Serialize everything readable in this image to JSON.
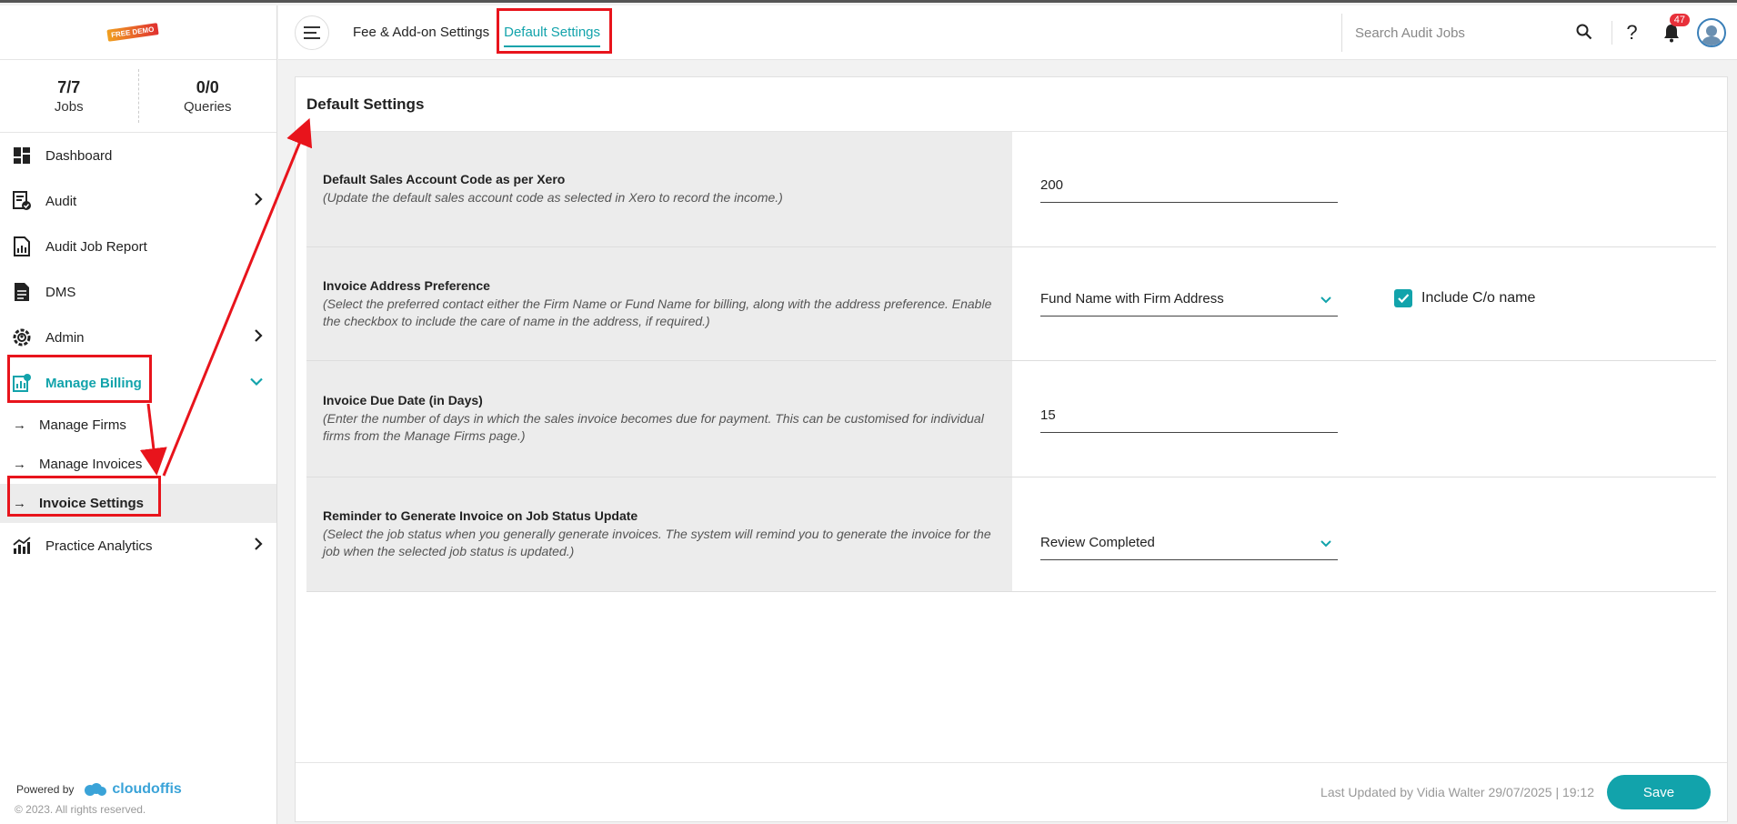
{
  "logo": {
    "badge_text": "FREE DEMO"
  },
  "stats": [
    {
      "value": "7/7",
      "label": "Jobs"
    },
    {
      "value": "0/0",
      "label": "Queries"
    }
  ],
  "sidebar": {
    "items": [
      {
        "label": "Dashboard",
        "icon": "dashboard-icon"
      },
      {
        "label": "Audit",
        "icon": "audit-icon"
      },
      {
        "label": "Audit Job Report",
        "icon": "report-icon"
      },
      {
        "label": "DMS",
        "icon": "document-icon"
      },
      {
        "label": "Admin",
        "icon": "admin-gear-icon"
      },
      {
        "label": "Manage Billing",
        "icon": "billing-icon"
      },
      {
        "label": "Practice Analytics",
        "icon": "analytics-icon"
      }
    ],
    "billing_sub": [
      {
        "label": "Manage Firms"
      },
      {
        "label": "Manage Invoices"
      },
      {
        "label": "Invoice Settings"
      }
    ],
    "powered_by": "Powered by",
    "brand": "cloudoffis",
    "copyright": "© 2023. All rights reserved."
  },
  "topbar": {
    "tabs": [
      {
        "label": "Fee & Add-on Settings"
      },
      {
        "label": "Default Settings"
      }
    ],
    "search_placeholder": "Search Audit Jobs",
    "help": "?",
    "notification_count": "47"
  },
  "main": {
    "title": "Default Settings",
    "rows": [
      {
        "title": "Default Sales Account Code as per Xero",
        "desc": "(Update the default sales account code as selected in Xero to record the income.)",
        "value": "200"
      },
      {
        "title": "Invoice Address Preference",
        "desc": "(Select the preferred contact either the Firm Name or Fund Name for billing, along with the address preference. Enable the checkbox to include the care of name in the address, if required.)",
        "value": "Fund Name with Firm Address",
        "checkbox_label": "Include C/o name"
      },
      {
        "title": "Invoice Due Date (in Days)",
        "desc": "(Enter the number of days in which the sales invoice becomes due for payment. This can be customised for individual firms from the Manage Firms page.)",
        "value": "15"
      },
      {
        "title": "Reminder to Generate Invoice on Job Status Update",
        "desc": "(Select the job status when you generally generate invoices. The system will remind you to generate the invoice for the job when the selected job status is updated.)",
        "value": "Review Completed"
      }
    ],
    "last_updated": "Last Updated by Vidia Walter 29/07/2025 | 19:12",
    "save_label": "Save"
  },
  "colors": {
    "accent": "#12a3ab",
    "annotation": "#e8141c",
    "badge": "#e8303a"
  }
}
